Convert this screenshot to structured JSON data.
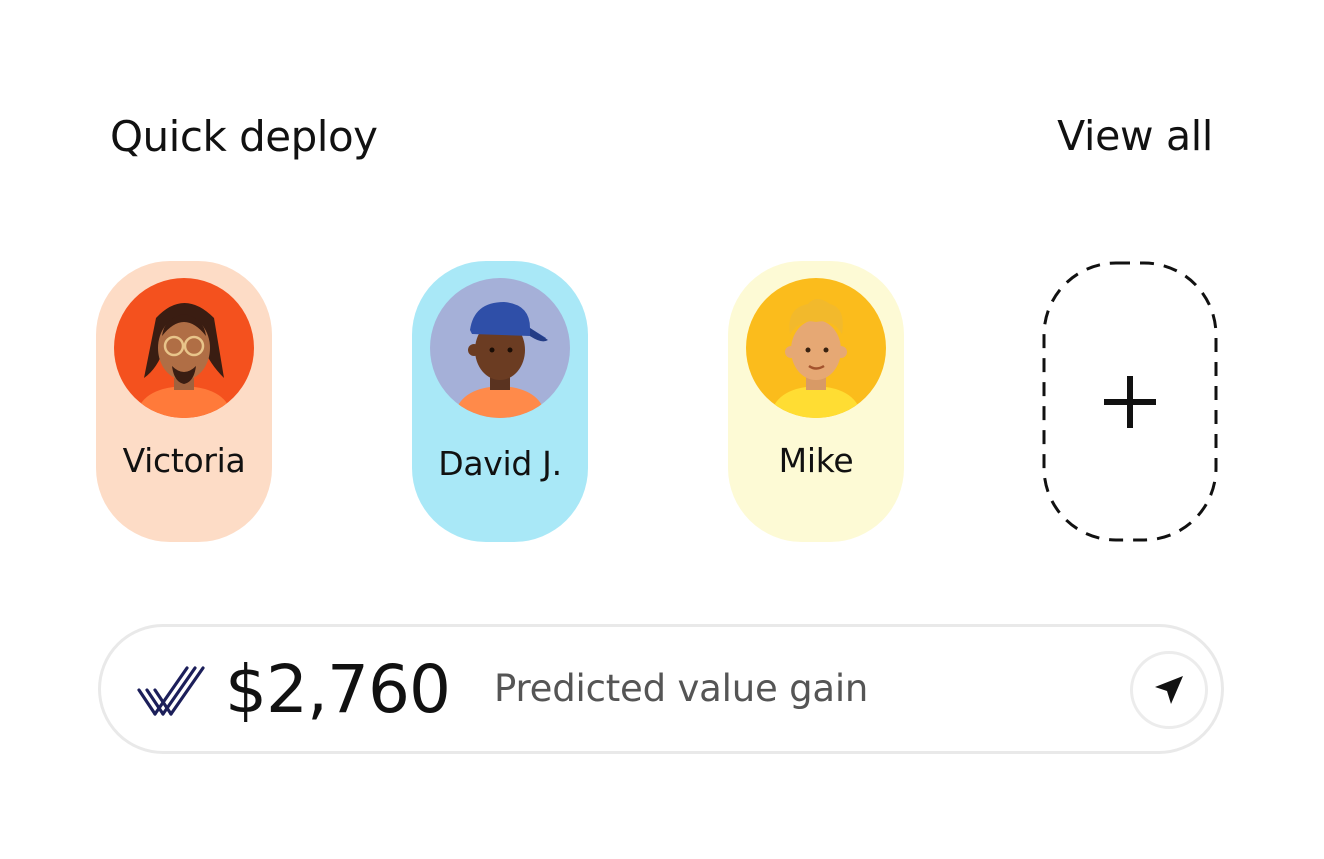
{
  "header": {
    "title": "Quick deploy",
    "view_all_label": "View all"
  },
  "contacts": [
    {
      "name": "Victoria",
      "card_color": "#fddcc6",
      "avatar_bg": "#f4511e",
      "avatar_icon": "avatar-icon"
    },
    {
      "name": "David J.",
      "card_color": "#a9e8f7",
      "avatar_bg": "#a5b0d8",
      "avatar_icon": "avatar-icon"
    },
    {
      "name": "Mike",
      "card_color": "#fdfad5",
      "avatar_bg": "#fbbc1c",
      "avatar_icon": "avatar-icon"
    }
  ],
  "add_contact": {
    "icon": "plus-icon"
  },
  "value_bar": {
    "logo_icon": "check-stripes-logo-icon",
    "amount": "$2,760",
    "caption": "Predicted value gain",
    "action_icon": "send-arrow-icon"
  }
}
